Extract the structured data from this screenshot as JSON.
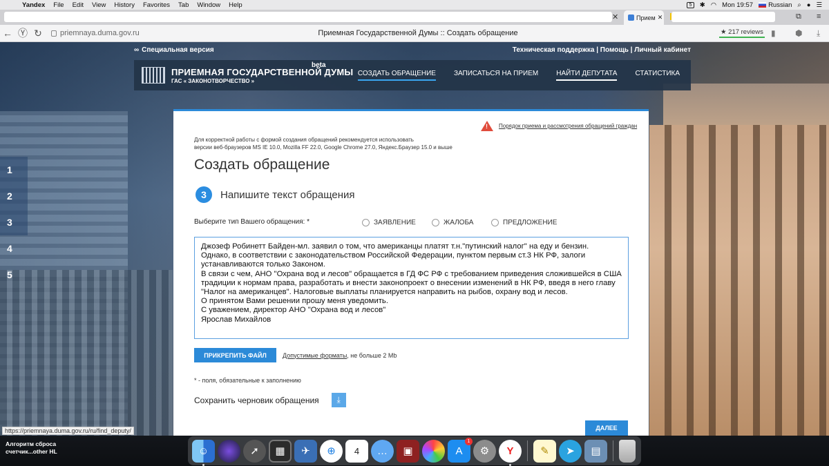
{
  "menubar": {
    "app": "Yandex",
    "items": [
      "File",
      "Edit",
      "View",
      "History",
      "Favorites",
      "Tab",
      "Window",
      "Help"
    ],
    "battery_badge": "5",
    "clock": "Mon 19:57",
    "language": "Russian"
  },
  "tabs": {
    "active_tab_label": "Прием"
  },
  "addressbar": {
    "url": "priemnaya.duma.gov.ru",
    "page_title": "Приемная Государственной Думы :: Создать обращение",
    "reviews": "★ 217 reviews"
  },
  "site": {
    "special_version": "Специальная версия",
    "top_links": "Техническая поддержка | Помощь | Личный кабинет",
    "logo_title": "ПРИЕМНАЯ ГОСУДАРСТВЕННОЙ ДУМЫ",
    "logo_sub": "ГАС « ЗАКОНОТВОРЧЕСТВО »",
    "beta": "beta",
    "nav": [
      "СОЗДАТЬ ОБРАЩЕНИЕ",
      "ЗАПИСАТЬСЯ НА ПРИЕМ",
      "НАЙТИ ДЕПУТАТА",
      "СТАТИСТИКА"
    ]
  },
  "side_steps": [
    "1",
    "2",
    "3",
    "4",
    "5"
  ],
  "form": {
    "notice_link": "Порядок приема и рассмотрения обращений граждан",
    "compat_line1": "Для корректной работы с формой создания обращений рекомендуется использовать",
    "compat_line2": "версии веб-браузеров MS IE 10.0, Mozilla FF 22.0, Google Chrome 27.0, Яндекс.Браузер 15.0 и выше",
    "title": "Создать обращение",
    "step_number": "3",
    "step_text": "Напишите текст обращения",
    "type_label": "Выберите тип Вашего обращения: *",
    "types": [
      "ЗАЯВЛЕНИЕ",
      "ЖАЛОБА",
      "ПРЕДЛОЖЕНИЕ"
    ],
    "text": "Джозеф Робинетт Байден-мл. заявил о том, что американцы платят т.н.\"путинский налог\" на еду и бензин.\nОднако, в соответствии с законодательством Российской Федерации, пунктом первым ст.3 НК РФ, залоги\nустанавливаются только Законом.\nВ связи с чем, АНО \"Охрана вод и лесов\" обращается в ГД ФС РФ с требованием приведения сложившейся в США\nтрадиции к нормам права, разработать и внести законопроект о внесении изменений в НК РФ, введя в него главу\n\"Налог на американцев\". Налоговые выплаты планируется направить на рыбов, охрану вод и лесов.\nО принятом Вами решении прошу меня уведомить.\nС уважением, директор АНО \"Охрана вод и лесов\"\nЯрослав Михайлов",
    "attach_button": "ПРИКРЕПИТЬ ФАЙЛ",
    "formats_link": "Допустимые форматы",
    "formats_rest": ", не больше 2 Mb",
    "required_note": "* - поля, обязательные к заполнению",
    "save_draft": "Сохранить черновик обращения",
    "next_button": "ДАЛЕЕ"
  },
  "status_url": "https://priemnaya.duma.gov.ru/ru/find_deputy/",
  "notification": {
    "line1": "Алгоритм сброса",
    "line2": "счетчик...other HL"
  },
  "dock": {
    "calendar_day": "4",
    "appstore_badge": "1"
  }
}
